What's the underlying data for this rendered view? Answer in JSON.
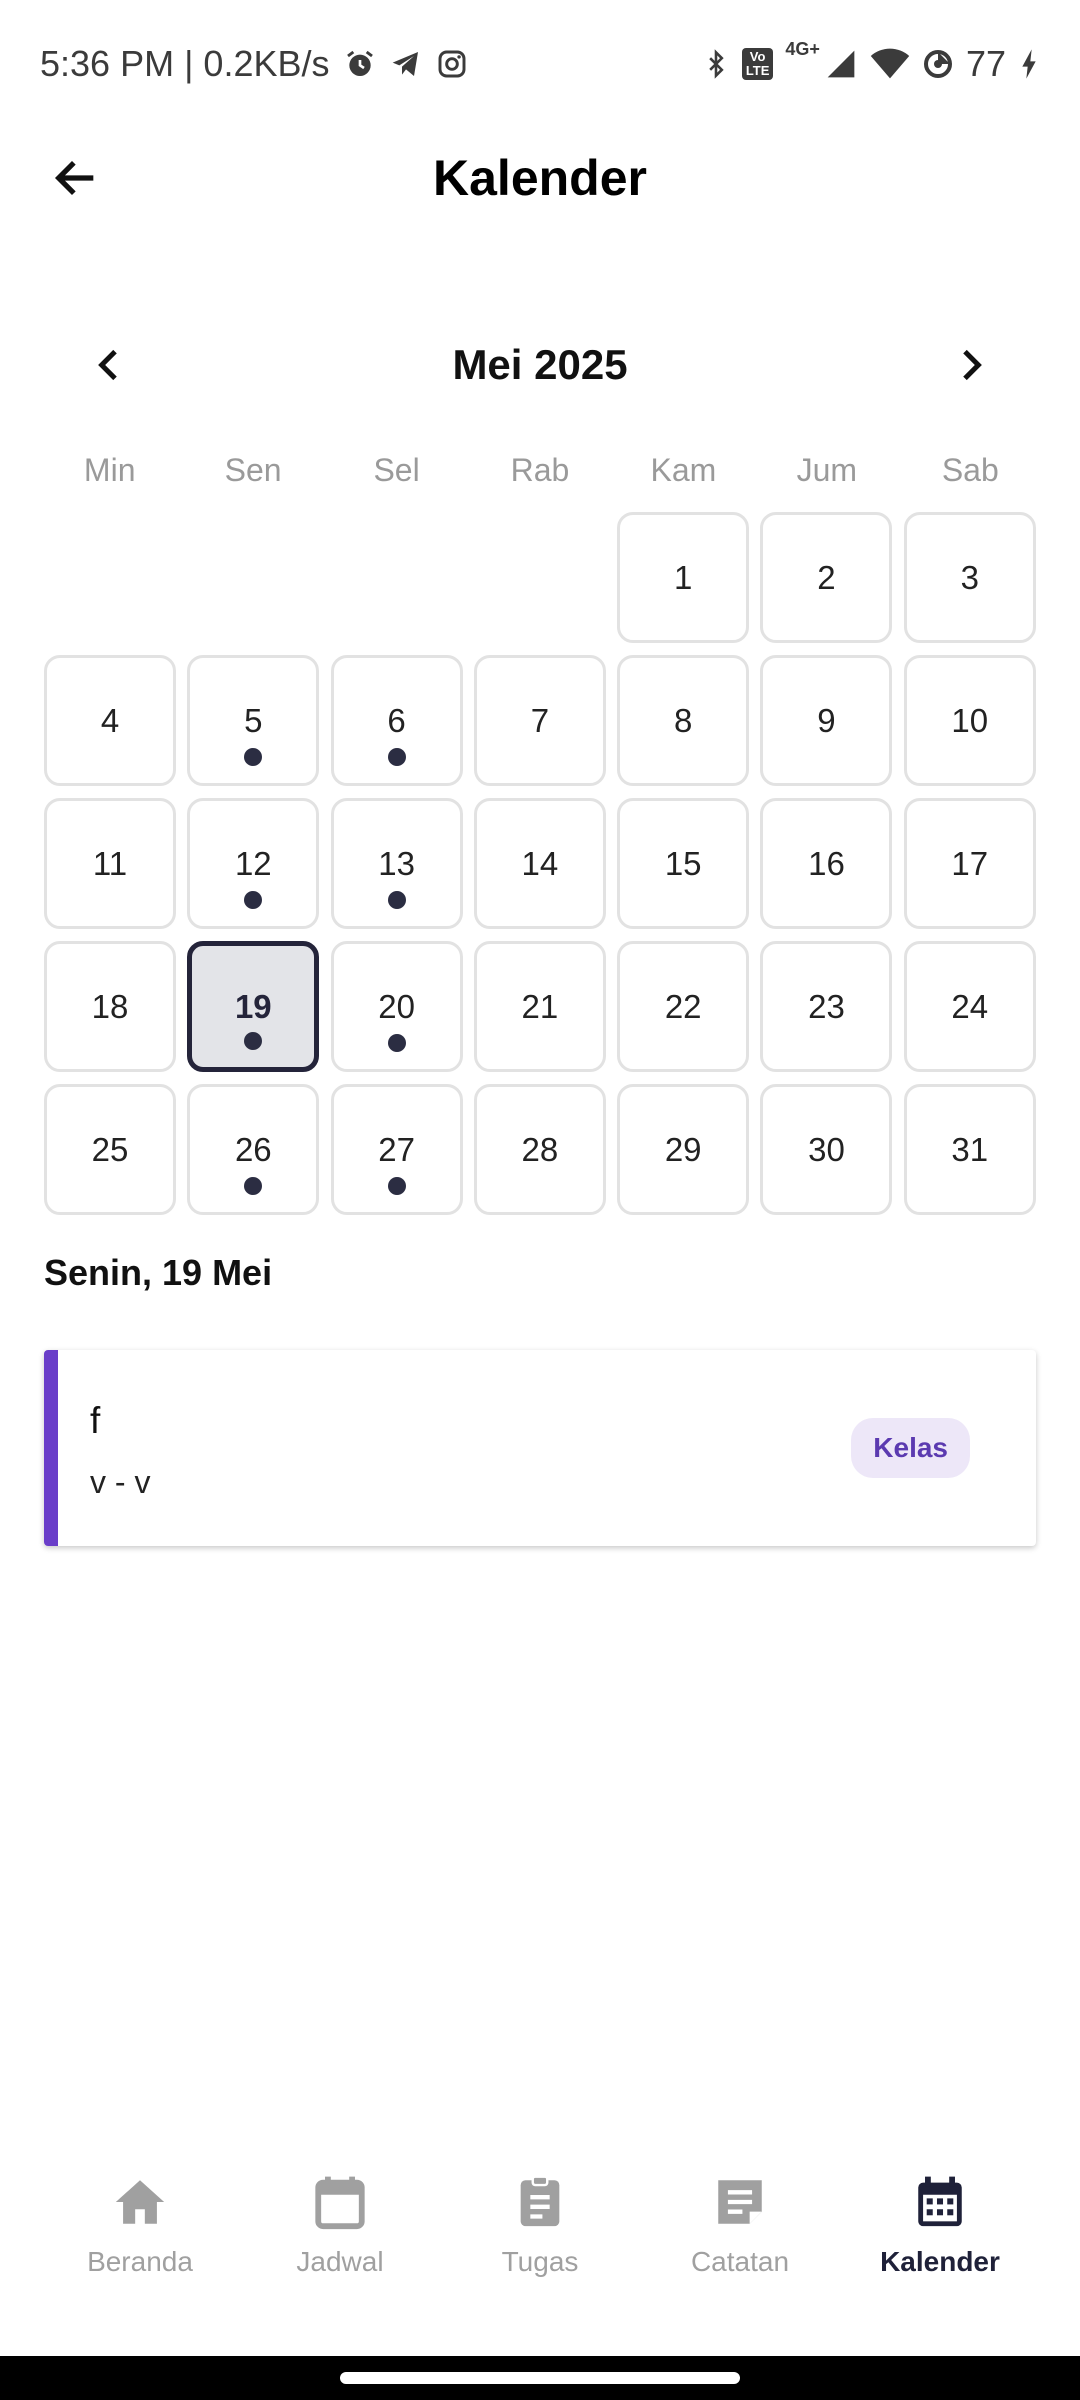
{
  "status_bar": {
    "time_speed": "5:36 PM | 0.2KB/s",
    "network": "4G+",
    "volte_line1": "Vo",
    "volte_line2": "LTE",
    "battery": "77"
  },
  "app_bar": {
    "title": "Kalender"
  },
  "calendar": {
    "month_label": "Mei 2025",
    "weekdays": [
      "Min",
      "Sen",
      "Sel",
      "Rab",
      "Kam",
      "Jum",
      "Sab"
    ],
    "leading_empty": 4,
    "days": [
      "1",
      "2",
      "3",
      "4",
      "5",
      "6",
      "7",
      "8",
      "9",
      "10",
      "11",
      "12",
      "13",
      "14",
      "15",
      "16",
      "17",
      "18",
      "19",
      "20",
      "21",
      "22",
      "23",
      "24",
      "25",
      "26",
      "27",
      "28",
      "29",
      "30",
      "31"
    ],
    "days_with_events": [
      "5",
      "6",
      "12",
      "13",
      "19",
      "20",
      "26",
      "27"
    ],
    "selected_day": "19"
  },
  "selected": {
    "date_label": "Senin, 19 Mei",
    "events": [
      {
        "title": "f",
        "time": "v - v",
        "type": "Kelas"
      }
    ]
  },
  "bottom_nav": [
    {
      "label": "Beranda",
      "icon": "home-icon",
      "active": false
    },
    {
      "label": "Jadwal",
      "icon": "calendar-blank-icon",
      "active": false
    },
    {
      "label": "Tugas",
      "icon": "clipboard-icon",
      "active": false
    },
    {
      "label": "Catatan",
      "icon": "note-icon",
      "active": false
    },
    {
      "label": "Kalender",
      "icon": "calendar-month-icon",
      "active": true
    }
  ],
  "colors": {
    "accent": "#6a3ec9",
    "selected_border": "#24243a",
    "selected_bg": "#e3e4e8",
    "badge_bg": "#ede7f8",
    "badge_text": "#5b3ab0",
    "nav_active": "#1f2139",
    "nav_inactive": "#a0a0a0"
  }
}
